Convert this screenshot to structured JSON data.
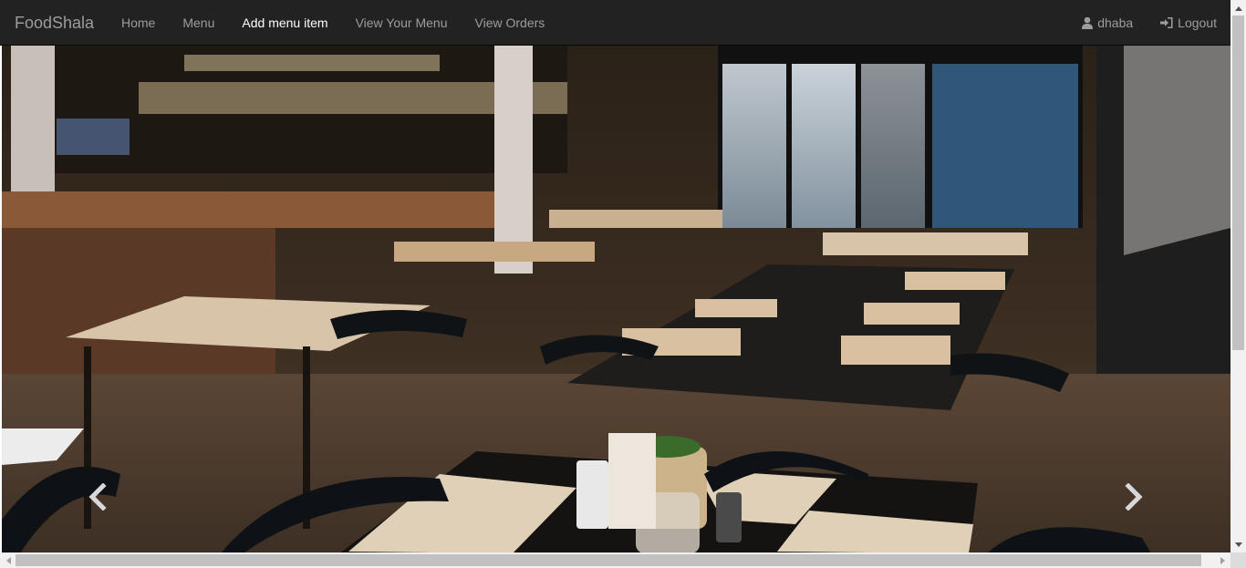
{
  "navbar": {
    "brand": "FoodShala",
    "items": [
      {
        "label": "Home"
      },
      {
        "label": "Menu"
      },
      {
        "label": "Add menu item"
      },
      {
        "label": "View Your Menu"
      },
      {
        "label": "View Orders"
      }
    ],
    "active_item": "Add menu item",
    "user": {
      "label": "dhaba",
      "icon": "user-icon"
    },
    "logout": {
      "label": "Logout",
      "icon": "log-in-icon"
    }
  },
  "carousel": {
    "image": "restaurant-interior-photo",
    "controls": {
      "previous": "chevron-left-icon",
      "next": "chevron-right-icon"
    }
  },
  "colors": {
    "navbar_bg": "#222222",
    "nav_text": "#9d9d9d",
    "nav_active": "#ffffff"
  }
}
